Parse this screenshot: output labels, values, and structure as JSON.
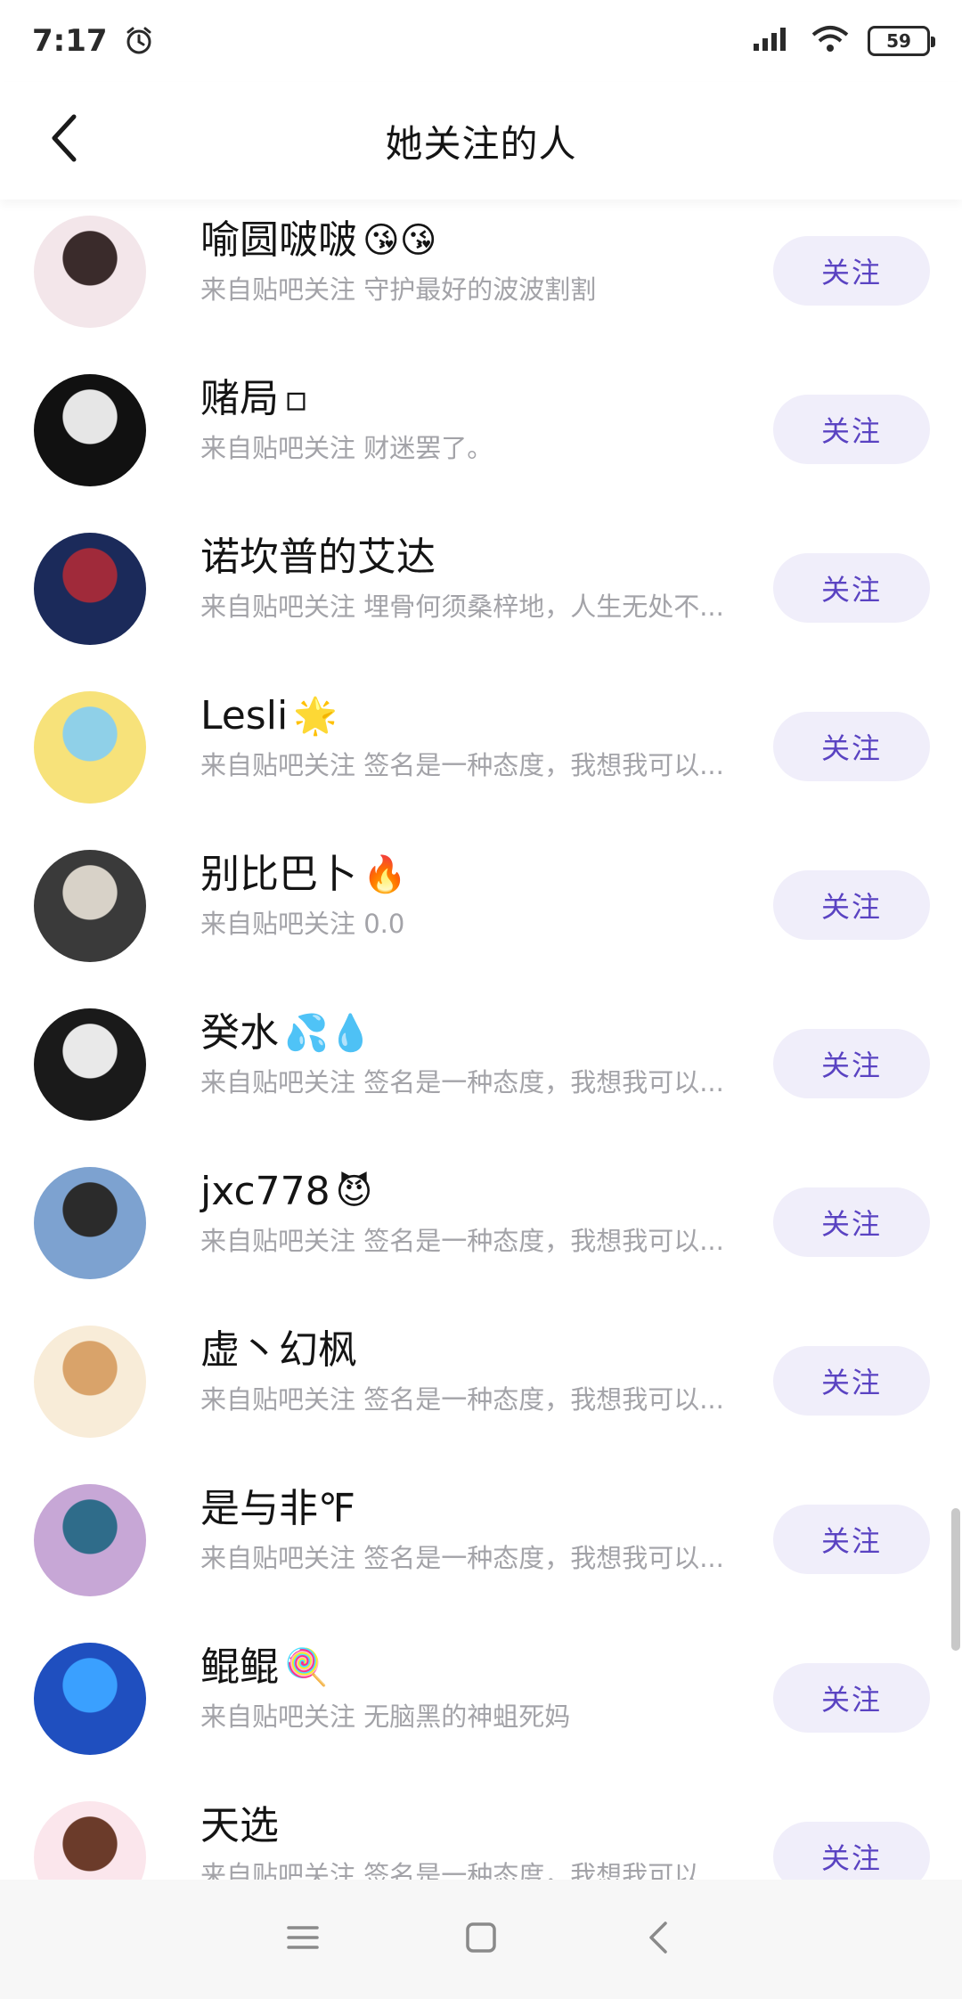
{
  "status_bar": {
    "time": "7:17",
    "battery": "59",
    "icons": [
      "alarm-icon",
      "signal-icon",
      "wifi-icon",
      "battery-icon"
    ]
  },
  "header": {
    "title": "她关注的人",
    "back_icon": "chevron-left-icon"
  },
  "follow_label": "关注",
  "users": [
    {
      "name": "喻圆啵啵",
      "emoji": "😘😘",
      "subtitle": "来自贴吧关注 守护最好的波波割割",
      "avatar_colors": [
        "#f3e6ea",
        "#3a2b2b"
      ]
    },
    {
      "name": "赌局",
      "emoji": "▫",
      "subtitle": "来自贴吧关注 财迷罢了。",
      "avatar_colors": [
        "#111111",
        "#e6e6e6"
      ]
    },
    {
      "name": "诺坎普的艾达",
      "emoji": "",
      "subtitle": "来自贴吧关注 埋骨何须桑梓地，人生无处不...",
      "avatar_colors": [
        "#1b2a5a",
        "#a02a3a"
      ]
    },
    {
      "name": "Lesli",
      "emoji": "🌟",
      "subtitle": "来自贴吧关注 签名是一种态度，我想我可以...",
      "avatar_colors": [
        "#f7e27a",
        "#8fd0e8"
      ]
    },
    {
      "name": "别比巴卜",
      "emoji": "🔥",
      "subtitle": "来自贴吧关注 0.0",
      "avatar_colors": [
        "#3a3a3a",
        "#d8d2c8"
      ]
    },
    {
      "name": "癸水",
      "emoji": "💦💧",
      "subtitle": "来自贴吧关注 签名是一种态度，我想我可以...",
      "avatar_colors": [
        "#1a1a1a",
        "#e9e9e9"
      ]
    },
    {
      "name": "jxc778",
      "emoji": "😈",
      "subtitle": "来自贴吧关注 签名是一种态度，我想我可以...",
      "avatar_colors": [
        "#7da2d0",
        "#2b2b2b"
      ]
    },
    {
      "name": "虚丶幻枫",
      "emoji": "",
      "subtitle": "来自贴吧关注 签名是一种态度，我想我可以...",
      "avatar_colors": [
        "#f8ecd8",
        "#d9a36a"
      ]
    },
    {
      "name": "是与非℉",
      "emoji": "",
      "subtitle": "来自贴吧关注 签名是一种态度，我想我可以...",
      "avatar_colors": [
        "#c7a7d6",
        "#2f6c8a"
      ]
    },
    {
      "name": "鲲鲲",
      "emoji": "🍭",
      "subtitle": "来自贴吧关注 无脑黑的神蛆死妈",
      "avatar_colors": [
        "#1f4fbf",
        "#3aa0ff"
      ]
    },
    {
      "name": "天选",
      "emoji": "",
      "subtitle": "来自贴吧关注 签名是一种态度，我想我可以...",
      "avatar_colors": [
        "#fbe6ec",
        "#6b3b2a"
      ]
    }
  ],
  "nav_bar": {
    "icons": [
      "menu-icon",
      "home-square-icon",
      "back-triangle-icon"
    ]
  }
}
